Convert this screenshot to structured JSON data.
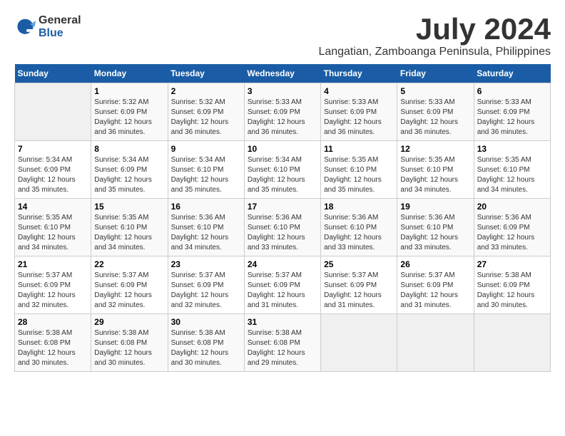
{
  "logo": {
    "general": "General",
    "blue": "Blue"
  },
  "title": "July 2024",
  "location": "Langatian, Zamboanga Peninsula, Philippines",
  "days_header": [
    "Sunday",
    "Monday",
    "Tuesday",
    "Wednesday",
    "Thursday",
    "Friday",
    "Saturday"
  ],
  "weeks": [
    [
      {
        "day": "",
        "sunrise": "",
        "sunset": "",
        "daylight": ""
      },
      {
        "day": "1",
        "sunrise": "Sunrise: 5:32 AM",
        "sunset": "Sunset: 6:09 PM",
        "daylight": "Daylight: 12 hours and 36 minutes."
      },
      {
        "day": "2",
        "sunrise": "Sunrise: 5:32 AM",
        "sunset": "Sunset: 6:09 PM",
        "daylight": "Daylight: 12 hours and 36 minutes."
      },
      {
        "day": "3",
        "sunrise": "Sunrise: 5:33 AM",
        "sunset": "Sunset: 6:09 PM",
        "daylight": "Daylight: 12 hours and 36 minutes."
      },
      {
        "day": "4",
        "sunrise": "Sunrise: 5:33 AM",
        "sunset": "Sunset: 6:09 PM",
        "daylight": "Daylight: 12 hours and 36 minutes."
      },
      {
        "day": "5",
        "sunrise": "Sunrise: 5:33 AM",
        "sunset": "Sunset: 6:09 PM",
        "daylight": "Daylight: 12 hours and 36 minutes."
      },
      {
        "day": "6",
        "sunrise": "Sunrise: 5:33 AM",
        "sunset": "Sunset: 6:09 PM",
        "daylight": "Daylight: 12 hours and 36 minutes."
      }
    ],
    [
      {
        "day": "7",
        "sunrise": "Sunrise: 5:34 AM",
        "sunset": "Sunset: 6:09 PM",
        "daylight": "Daylight: 12 hours and 35 minutes."
      },
      {
        "day": "8",
        "sunrise": "Sunrise: 5:34 AM",
        "sunset": "Sunset: 6:09 PM",
        "daylight": "Daylight: 12 hours and 35 minutes."
      },
      {
        "day": "9",
        "sunrise": "Sunrise: 5:34 AM",
        "sunset": "Sunset: 6:10 PM",
        "daylight": "Daylight: 12 hours and 35 minutes."
      },
      {
        "day": "10",
        "sunrise": "Sunrise: 5:34 AM",
        "sunset": "Sunset: 6:10 PM",
        "daylight": "Daylight: 12 hours and 35 minutes."
      },
      {
        "day": "11",
        "sunrise": "Sunrise: 5:35 AM",
        "sunset": "Sunset: 6:10 PM",
        "daylight": "Daylight: 12 hours and 35 minutes."
      },
      {
        "day": "12",
        "sunrise": "Sunrise: 5:35 AM",
        "sunset": "Sunset: 6:10 PM",
        "daylight": "Daylight: 12 hours and 34 minutes."
      },
      {
        "day": "13",
        "sunrise": "Sunrise: 5:35 AM",
        "sunset": "Sunset: 6:10 PM",
        "daylight": "Daylight: 12 hours and 34 minutes."
      }
    ],
    [
      {
        "day": "14",
        "sunrise": "Sunrise: 5:35 AM",
        "sunset": "Sunset: 6:10 PM",
        "daylight": "Daylight: 12 hours and 34 minutes."
      },
      {
        "day": "15",
        "sunrise": "Sunrise: 5:35 AM",
        "sunset": "Sunset: 6:10 PM",
        "daylight": "Daylight: 12 hours and 34 minutes."
      },
      {
        "day": "16",
        "sunrise": "Sunrise: 5:36 AM",
        "sunset": "Sunset: 6:10 PM",
        "daylight": "Daylight: 12 hours and 34 minutes."
      },
      {
        "day": "17",
        "sunrise": "Sunrise: 5:36 AM",
        "sunset": "Sunset: 6:10 PM",
        "daylight": "Daylight: 12 hours and 33 minutes."
      },
      {
        "day": "18",
        "sunrise": "Sunrise: 5:36 AM",
        "sunset": "Sunset: 6:10 PM",
        "daylight": "Daylight: 12 hours and 33 minutes."
      },
      {
        "day": "19",
        "sunrise": "Sunrise: 5:36 AM",
        "sunset": "Sunset: 6:10 PM",
        "daylight": "Daylight: 12 hours and 33 minutes."
      },
      {
        "day": "20",
        "sunrise": "Sunrise: 5:36 AM",
        "sunset": "Sunset: 6:09 PM",
        "daylight": "Daylight: 12 hours and 33 minutes."
      }
    ],
    [
      {
        "day": "21",
        "sunrise": "Sunrise: 5:37 AM",
        "sunset": "Sunset: 6:09 PM",
        "daylight": "Daylight: 12 hours and 32 minutes."
      },
      {
        "day": "22",
        "sunrise": "Sunrise: 5:37 AM",
        "sunset": "Sunset: 6:09 PM",
        "daylight": "Daylight: 12 hours and 32 minutes."
      },
      {
        "day": "23",
        "sunrise": "Sunrise: 5:37 AM",
        "sunset": "Sunset: 6:09 PM",
        "daylight": "Daylight: 12 hours and 32 minutes."
      },
      {
        "day": "24",
        "sunrise": "Sunrise: 5:37 AM",
        "sunset": "Sunset: 6:09 PM",
        "daylight": "Daylight: 12 hours and 31 minutes."
      },
      {
        "day": "25",
        "sunrise": "Sunrise: 5:37 AM",
        "sunset": "Sunset: 6:09 PM",
        "daylight": "Daylight: 12 hours and 31 minutes."
      },
      {
        "day": "26",
        "sunrise": "Sunrise: 5:37 AM",
        "sunset": "Sunset: 6:09 PM",
        "daylight": "Daylight: 12 hours and 31 minutes."
      },
      {
        "day": "27",
        "sunrise": "Sunrise: 5:38 AM",
        "sunset": "Sunset: 6:09 PM",
        "daylight": "Daylight: 12 hours and 30 minutes."
      }
    ],
    [
      {
        "day": "28",
        "sunrise": "Sunrise: 5:38 AM",
        "sunset": "Sunset: 6:08 PM",
        "daylight": "Daylight: 12 hours and 30 minutes."
      },
      {
        "day": "29",
        "sunrise": "Sunrise: 5:38 AM",
        "sunset": "Sunset: 6:08 PM",
        "daylight": "Daylight: 12 hours and 30 minutes."
      },
      {
        "day": "30",
        "sunrise": "Sunrise: 5:38 AM",
        "sunset": "Sunset: 6:08 PM",
        "daylight": "Daylight: 12 hours and 30 minutes."
      },
      {
        "day": "31",
        "sunrise": "Sunrise: 5:38 AM",
        "sunset": "Sunset: 6:08 PM",
        "daylight": "Daylight: 12 hours and 29 minutes."
      },
      {
        "day": "",
        "sunrise": "",
        "sunset": "",
        "daylight": ""
      },
      {
        "day": "",
        "sunrise": "",
        "sunset": "",
        "daylight": ""
      },
      {
        "day": "",
        "sunrise": "",
        "sunset": "",
        "daylight": ""
      }
    ]
  ]
}
